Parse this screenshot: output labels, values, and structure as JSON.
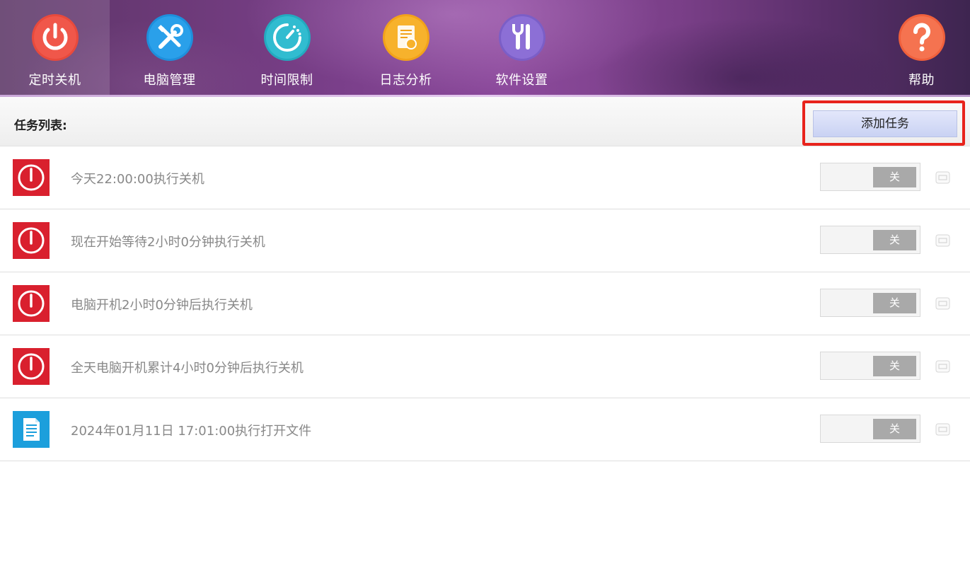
{
  "nav": {
    "items": [
      {
        "label": "定时关机",
        "icon": "power-icon",
        "color": "#e84a3c",
        "active": true
      },
      {
        "label": "电脑管理",
        "icon": "tools-icon",
        "color": "#1e8fdc"
      },
      {
        "label": "时间限制",
        "icon": "timer-icon",
        "color": "#23aac0"
      },
      {
        "label": "日志分析",
        "icon": "log-icon",
        "color": "#f2a21a"
      },
      {
        "label": "软件设置",
        "icon": "settings-icon",
        "color": "#7b5ec7"
      }
    ],
    "help": {
      "label": "帮助",
      "icon": "help-icon",
      "color": "#f0603c"
    }
  },
  "task_header": {
    "title": "任务列表:",
    "add_button_label": "添加任务"
  },
  "tasks": [
    {
      "text": "今天22:00:00执行关机",
      "icon": "shutdown-icon",
      "toggle_label": "关"
    },
    {
      "text": "现在开始等待2小时0分钟执行关机",
      "icon": "shutdown-icon",
      "toggle_label": "关"
    },
    {
      "text": "电脑开机2小时0分钟后执行关机",
      "icon": "shutdown-icon",
      "toggle_label": "关"
    },
    {
      "text": "全天电脑开机累计4小时0分钟后执行关机",
      "icon": "shutdown-icon",
      "toggle_label": "关"
    },
    {
      "text": "2024年01月11日 17:01:00执行打开文件",
      "icon": "document-icon",
      "toggle_label": "关"
    }
  ],
  "colors": {
    "shutdown_red": "#d9202e",
    "document_blue": "#1c9fdc",
    "highlight_red": "#e8231c"
  }
}
